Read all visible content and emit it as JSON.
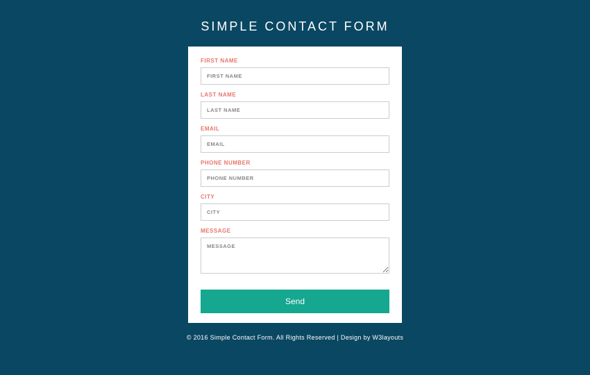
{
  "header": {
    "title": "SIMPLE CONTACT FORM"
  },
  "form": {
    "first_name": {
      "label": "FIRST NAME",
      "placeholder": "FIRST NAME"
    },
    "last_name": {
      "label": "LAST NAME",
      "placeholder": "LAST NAME"
    },
    "email": {
      "label": "EMAIL",
      "placeholder": "EMAIL"
    },
    "phone": {
      "label": "PHONE NUMBER",
      "placeholder": "PHONE NUMBER"
    },
    "city": {
      "label": "CITY",
      "placeholder": "CITY"
    },
    "message": {
      "label": "MESSAGE",
      "placeholder": "MESSAGE"
    },
    "submit_label": "Send"
  },
  "footer": {
    "prefix": "© 2016 Simple Contact Form. All Rights Reserved | Design by ",
    "link_text": "W3layouts"
  }
}
